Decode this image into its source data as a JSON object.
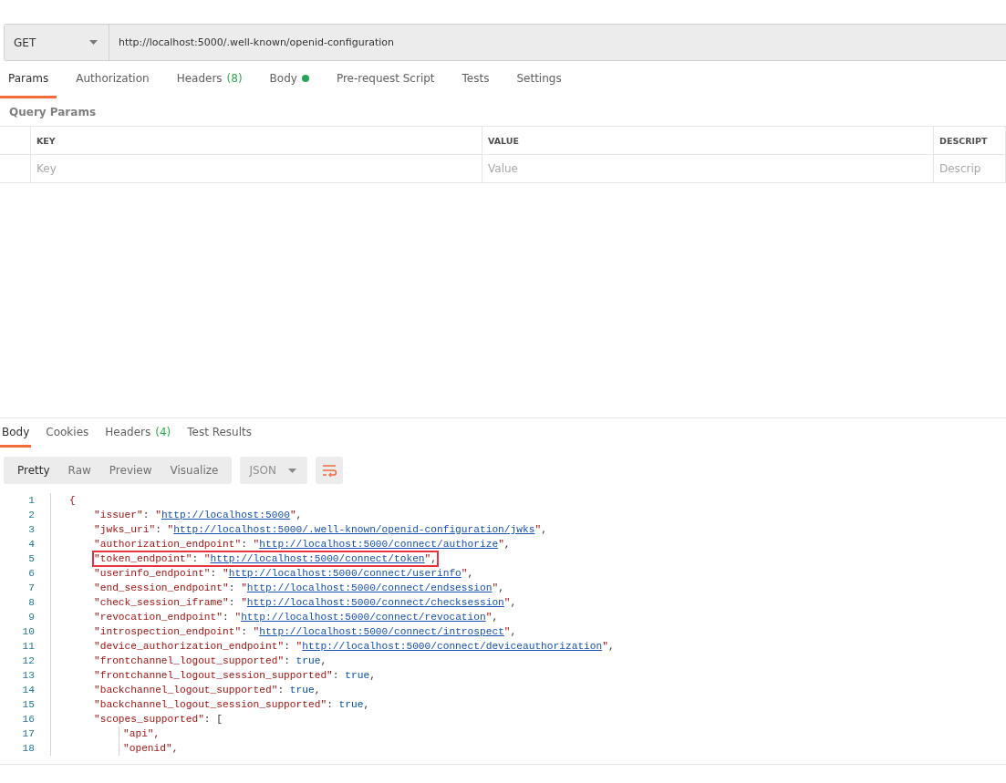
{
  "request": {
    "method": "GET",
    "url": "http://localhost:5000/.well-known/openid-configuration"
  },
  "request_tabs": [
    {
      "label": "Params",
      "selected": true
    },
    {
      "label": "Authorization",
      "selected": false
    },
    {
      "label": "Headers",
      "count": "(8)",
      "selected": false
    },
    {
      "label": "Body",
      "dot": true,
      "selected": false
    },
    {
      "label": "Pre-request Script",
      "selected": false
    },
    {
      "label": "Tests",
      "selected": false
    },
    {
      "label": "Settings",
      "selected": false
    }
  ],
  "query_params": {
    "title": "Query Params",
    "columns": [
      "KEY",
      "VALUE",
      "DESCRIPT"
    ],
    "placeholders": [
      "Key",
      "Value",
      "Descrip"
    ]
  },
  "response_tabs": [
    {
      "label": "Body",
      "selected": true
    },
    {
      "label": "Cookies",
      "selected": false
    },
    {
      "label": "Headers",
      "count": "(4)",
      "selected": false
    },
    {
      "label": "Test Results",
      "selected": false
    }
  ],
  "view_modes": [
    {
      "label": "Pretty",
      "selected": true
    },
    {
      "label": "Raw",
      "selected": false
    },
    {
      "label": "Preview",
      "selected": false
    },
    {
      "label": "Visualize",
      "selected": false
    }
  ],
  "format": "JSON",
  "code_lines": [
    {
      "num": "1",
      "text": "{"
    },
    {
      "num": "2",
      "key": "\"issuer\"",
      "sep": ":",
      "value": "\"http://localhost:5000\"",
      "kind": "link",
      "tail": ",",
      "highlighted": false
    },
    {
      "num": "3",
      "key": "\"jwks_uri\"",
      "sep": ":",
      "value": "\"http://localhost:5000/.well-known/openid-configuration/jwks\"",
      "kind": "link",
      "tail": ",",
      "highlighted": false
    },
    {
      "num": "4",
      "key": "\"authorization_endpoint\"",
      "sep": ":",
      "value": "\"http://localhost:5000/connect/authorize\"",
      "kind": "link",
      "tail": ",",
      "highlighted": false
    },
    {
      "num": "5",
      "key": "\"token_endpoint\"",
      "sep": ":",
      "value": "\"http://localhost:5000/connect/token\"",
      "kind": "link",
      "tail": ",",
      "highlighted": true
    },
    {
      "num": "6",
      "key": "\"userinfo_endpoint\"",
      "sep": ":",
      "value": "\"http://localhost:5000/connect/userinfo\"",
      "kind": "link",
      "tail": ",",
      "highlighted": false
    },
    {
      "num": "7",
      "key": "\"end_session_endpoint\"",
      "sep": ":",
      "value": "\"http://localhost:5000/connect/endsession\"",
      "kind": "link",
      "tail": ",",
      "highlighted": false
    },
    {
      "num": "8",
      "key": "\"check_session_iframe\"",
      "sep": ":",
      "value": "\"http://localhost:5000/connect/checksession\"",
      "kind": "link",
      "tail": ",",
      "highlighted": false
    },
    {
      "num": "9",
      "key": "\"revocation_endpoint\"",
      "sep": ":",
      "value": "\"http://localhost:5000/connect/revocation\"",
      "kind": "link",
      "tail": ",",
      "highlighted": false
    },
    {
      "num": "10",
      "key": "\"introspection_endpoint\"",
      "sep": ":",
      "value": "\"http://localhost:5000/connect/introspect\"",
      "kind": "link",
      "tail": ",",
      "highlighted": false
    },
    {
      "num": "11",
      "key": "\"device_authorization_endpoint\"",
      "sep": ":",
      "value": "\"http://localhost:5000/connect/deviceauthorization\"",
      "kind": "link",
      "tail": ",",
      "highlighted": false
    },
    {
      "num": "12",
      "key": "\"frontchannel_logout_supported\"",
      "sep": ":",
      "value": "true",
      "kind": "bool",
      "tail": ",",
      "highlighted": false
    },
    {
      "num": "13",
      "key": "\"frontchannel_logout_session_supported\"",
      "sep": ":",
      "value": "true",
      "kind": "bool",
      "tail": ",",
      "highlighted": false
    },
    {
      "num": "14",
      "key": "\"backchannel_logout_supported\"",
      "sep": ":",
      "value": "true",
      "kind": "bool",
      "tail": ",",
      "highlighted": false
    },
    {
      "num": "15",
      "key": "\"backchannel_logout_session_supported\"",
      "sep": ":",
      "value": "true",
      "kind": "bool",
      "tail": ",",
      "highlighted": false
    },
    {
      "num": "16",
      "key": "\"scopes_supported\"",
      "sep": ":",
      "value": "[",
      "kind": "punct",
      "highlighted": false,
      "children": [
        {
          "num": "17",
          "text": "\"api\","
        },
        {
          "num": "18",
          "text": "\"openid\","
        }
      ]
    }
  ]
}
